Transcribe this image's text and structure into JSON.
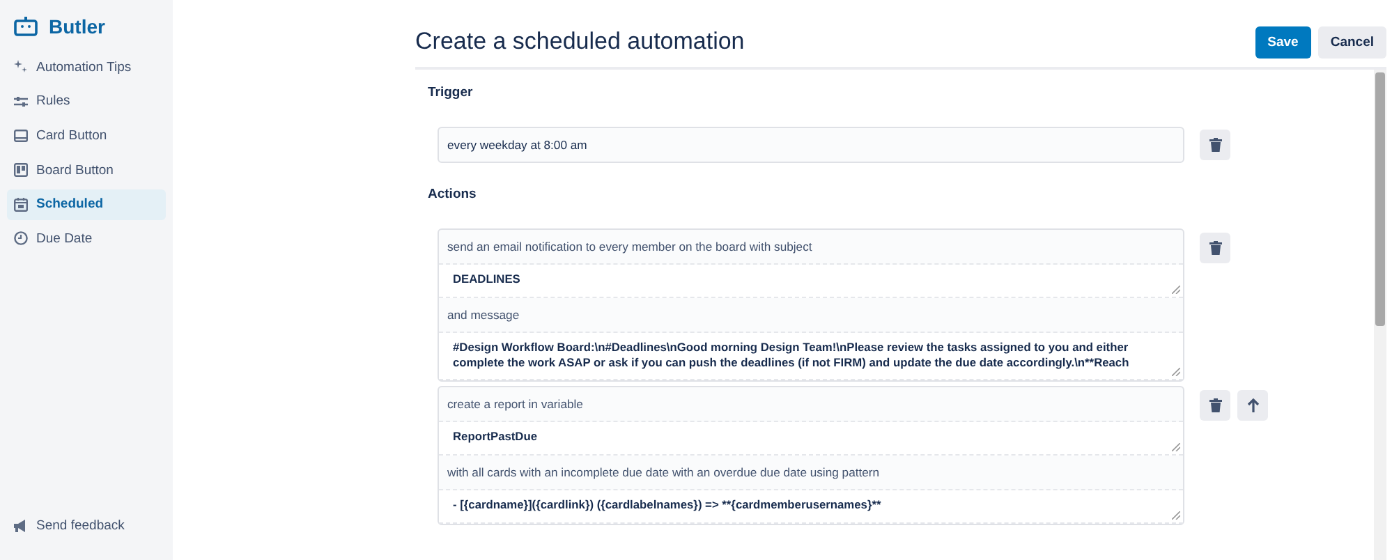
{
  "sidebar": {
    "brand": "Butler",
    "items": [
      {
        "label": "Automation Tips",
        "selected": false
      },
      {
        "label": "Rules",
        "selected": false
      },
      {
        "label": "Card Button",
        "selected": false
      },
      {
        "label": "Board Button",
        "selected": false
      },
      {
        "label": "Scheduled",
        "selected": true
      },
      {
        "label": "Due Date",
        "selected": false
      }
    ],
    "footer_items": [
      {
        "label": "Send feedback"
      }
    ]
  },
  "header": {
    "title": "Create a scheduled automation",
    "buttons": [
      {
        "label": "Save",
        "kind": "primary"
      },
      {
        "label": "Cancel",
        "kind": "secondary"
      }
    ]
  },
  "trigger": {
    "heading": "Trigger",
    "value": "every weekday at 8:00 am"
  },
  "actions": {
    "heading": "Actions",
    "items": [
      {
        "move_up": false,
        "rows": [
          {
            "kind": "text",
            "text": "send an email notification to every member on the board with subject"
          },
          {
            "kind": "field",
            "value": "DEADLINES"
          },
          {
            "kind": "text",
            "text": "and message"
          },
          {
            "kind": "field",
            "value": "#Design Workflow Board:\\n#Deadlines\\nGood morning Design Team!\\nPlease review the tasks assigned to you and either complete the work ASAP or ask if you can push the deadlines (if not FIRM) and update the due date accordingly.\\n**Reach"
          }
        ]
      },
      {
        "move_up": true,
        "rows": [
          {
            "kind": "text",
            "text": "create a report in variable"
          },
          {
            "kind": "field",
            "value": "ReportPastDue"
          },
          {
            "kind": "text",
            "text": "with all cards with an incomplete due date with an overdue due date using pattern"
          },
          {
            "kind": "field",
            "value": "- [{cardname}]({cardlink}) ({cardlabelnames}) => **{cardmemberusernames}**"
          }
        ]
      }
    ]
  }
}
